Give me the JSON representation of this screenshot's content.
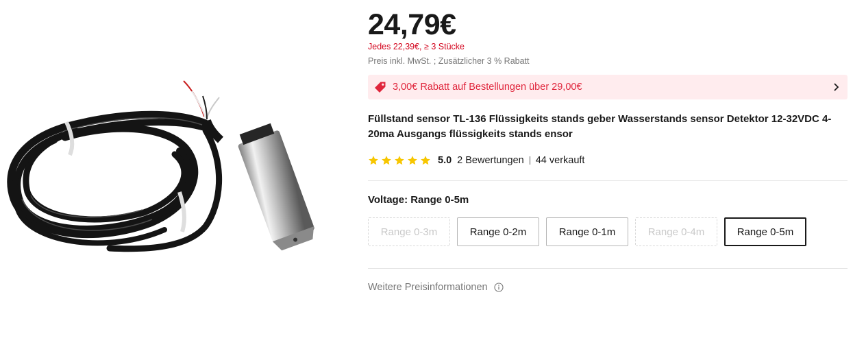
{
  "product": {
    "image_alt": "",
    "price": "24,79€",
    "tier_price": "Jedes 22,39€, ≥ 3 Stücke",
    "vat_note": "Preis inkl. MwSt. ; Zusätzlicher 3 % Rabatt",
    "promo": {
      "text": "3,00€ Rabatt auf Bestellungen über 29,00€",
      "icon": "tag-icon",
      "accent_color": "#e0263c",
      "background": "#ffecee"
    },
    "title": "Füllstand sensor TL-136 Flüssigkeits stands geber Wasserstands sensor Detektor 12-32VDC 4-20ma Ausgangs flüssigkeits stands ensor",
    "rating": {
      "stars": 5,
      "score": "5.0",
      "reviews": "2 Bewertungen",
      "sold": "44 verkauft",
      "star_color": "#f7c600"
    },
    "variant": {
      "label": "Voltage: Range 0-5m",
      "options": [
        {
          "label": "Range 0-3m",
          "state": "disabled"
        },
        {
          "label": "Range 0-2m",
          "state": "available"
        },
        {
          "label": "Range 0-1m",
          "state": "available"
        },
        {
          "label": "Range 0-4m",
          "state": "disabled"
        },
        {
          "label": "Range 0-5m",
          "state": "selected"
        }
      ]
    },
    "more_info": "Weitere Preisinformationen"
  }
}
